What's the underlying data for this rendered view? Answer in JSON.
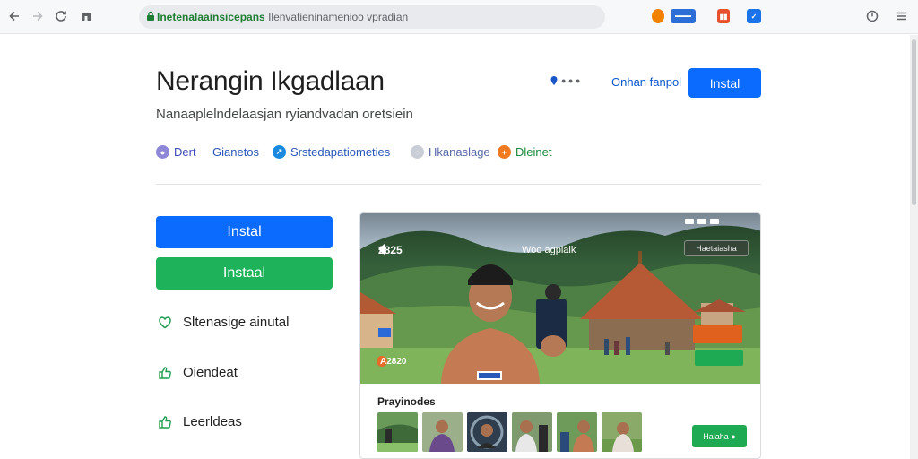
{
  "browser": {
    "url_host": "Inetenalaainsicepans",
    "url_path": " Ilenvatieninamenioo vpradian",
    "extensions": [
      {
        "name": "ext-orange",
        "color": "#f08200",
        "label": "●"
      },
      {
        "name": "ext-badge",
        "color": "#2b6fd6",
        "label": "N●●●"
      },
      {
        "name": "ext-red",
        "color": "#e8502d",
        "label": "▮"
      },
      {
        "name": "ext-blue",
        "color": "#1a73e8",
        "label": "✓"
      }
    ]
  },
  "header": {
    "title": "Nerangin Ikgadlaan",
    "subtitle": "Nanaaplelndelaasjan ryiandvadan oretsiein",
    "share_label": "● ● ●",
    "download_link": "Onhan fanpol",
    "install_top": "Instal"
  },
  "meta": [
    {
      "label": "Dert",
      "color": "#8e87d8",
      "text_color": "#3c4ab8"
    },
    {
      "label": "Gianetos",
      "color": null,
      "text_color": "#2a56b8"
    },
    {
      "label": "Srstedapatiometies",
      "color": "#1a8ae0",
      "text_color": "#2a56b8"
    },
    {
      "label": "Hkanaslage",
      "color": "#c9cdd6",
      "text_color": "#5a6aa8"
    },
    {
      "label": "Dleinet",
      "color": "#ef7a22",
      "text_color": "#1a8a3e"
    }
  ],
  "left": {
    "install_primary": "Instal",
    "install_secondary": "Instaal",
    "items": [
      {
        "label": "Sltenasige ainutal",
        "icon": "heart-icon"
      },
      {
        "label": "Oiendeat",
        "icon": "thumbs-up-icon"
      },
      {
        "label": "Leerldeas",
        "icon": "thumbs-up-icon"
      }
    ]
  },
  "card": {
    "time": "2825",
    "caption": "Woo agplalk",
    "pill": "Haetaiasha",
    "tag": "A2820",
    "previews_title": "Prayinodes",
    "thumb_labels": [
      "▬▬▬",
      "",
      "▬▬▬",
      "",
      "▬▬▬",
      "▬▬▬"
    ],
    "more_button": "Haiaha ●"
  },
  "colors": {
    "primary_blue": "#0b6bff",
    "install_green": "#1eb35a",
    "link_blue": "#0b57d0",
    "url_green": "#1e7d32"
  }
}
